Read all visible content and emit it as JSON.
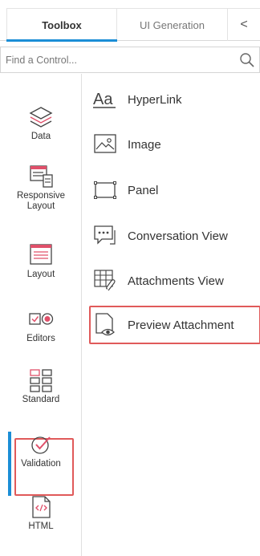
{
  "tabs": {
    "toolbox": "Toolbox",
    "ui_generation": "UI Generation",
    "collapse": "<"
  },
  "search": {
    "placeholder": "Find a Control...",
    "icon": "search-icon"
  },
  "categories": [
    {
      "label": "Data",
      "icon": "layers-icon"
    },
    {
      "label": "Responsive\nLayout",
      "icon": "responsive-layout-icon"
    },
    {
      "label": "Layout",
      "icon": "layout-icon"
    },
    {
      "label": "Editors",
      "icon": "editors-icon"
    },
    {
      "label": "Standard",
      "icon": "standard-grid-icon",
      "active": true,
      "highlighted": true
    },
    {
      "label": "Validation",
      "icon": "validation-check-icon"
    },
    {
      "label": "HTML",
      "icon": "html-code-icon"
    }
  ],
  "controls": [
    {
      "label": "HyperLink",
      "icon": "hyperlink-aa-icon"
    },
    {
      "label": "Image",
      "icon": "image-icon"
    },
    {
      "label": "Panel",
      "icon": "panel-icon"
    },
    {
      "label": "Conversation View",
      "icon": "conversation-icon"
    },
    {
      "label": "Attachments View",
      "icon": "attachments-icon"
    },
    {
      "label": "Preview Attachment",
      "icon": "preview-attachment-icon",
      "highlighted": true
    }
  ],
  "colors": {
    "accent": "#1b8ed6",
    "highlight": "#e05a5a",
    "icon_red": "#e0506a"
  }
}
